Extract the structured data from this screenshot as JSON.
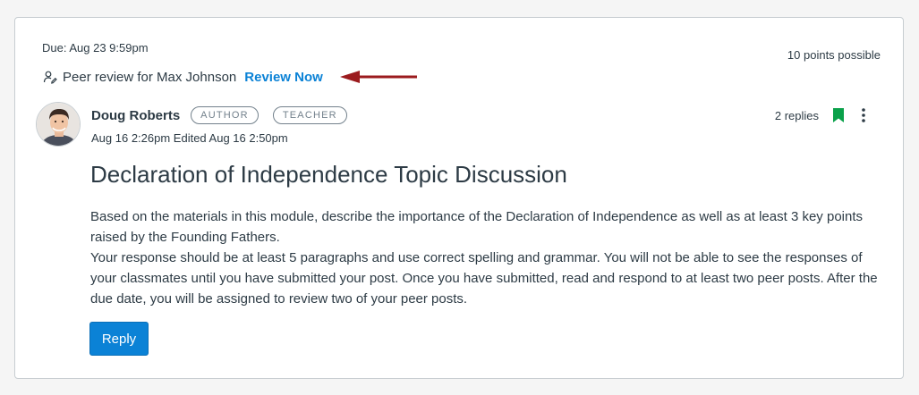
{
  "assignment": {
    "due": "Due: Aug 23 9:59pm",
    "points": "10 points possible"
  },
  "peer_review": {
    "text": "Peer review for Max Johnson",
    "link_label": "Review Now",
    "icon": "peer-review-icon"
  },
  "post": {
    "author": "Doug Roberts",
    "badges": [
      "AUTHOR",
      "TEACHER"
    ],
    "dates": "Aug 16 2:26pm  Edited Aug 16 2:50pm",
    "replies": "2 replies",
    "title": "Declaration of Independence Topic Discussion",
    "paragraphs": [
      "Based on the materials in this module, describe the importance of the Declaration of Independence as well as at least 3 key points raised by the Founding Fathers.",
      "Your response should be at least 5 paragraphs and use correct spelling and grammar. You will not be able to see the responses of your classmates until you have submitted your post. Once you have submitted, read and respond to at least two peer posts. After the due date, you will be assigned to review two of your peer posts."
    ],
    "reply_label": "Reply"
  },
  "colors": {
    "link": "#0b82d6",
    "button": "#0b82d6",
    "bookmark": "#0aa14a",
    "arrow": "#9b1b1e",
    "text": "#2d3b45",
    "pill": "#73818c"
  }
}
